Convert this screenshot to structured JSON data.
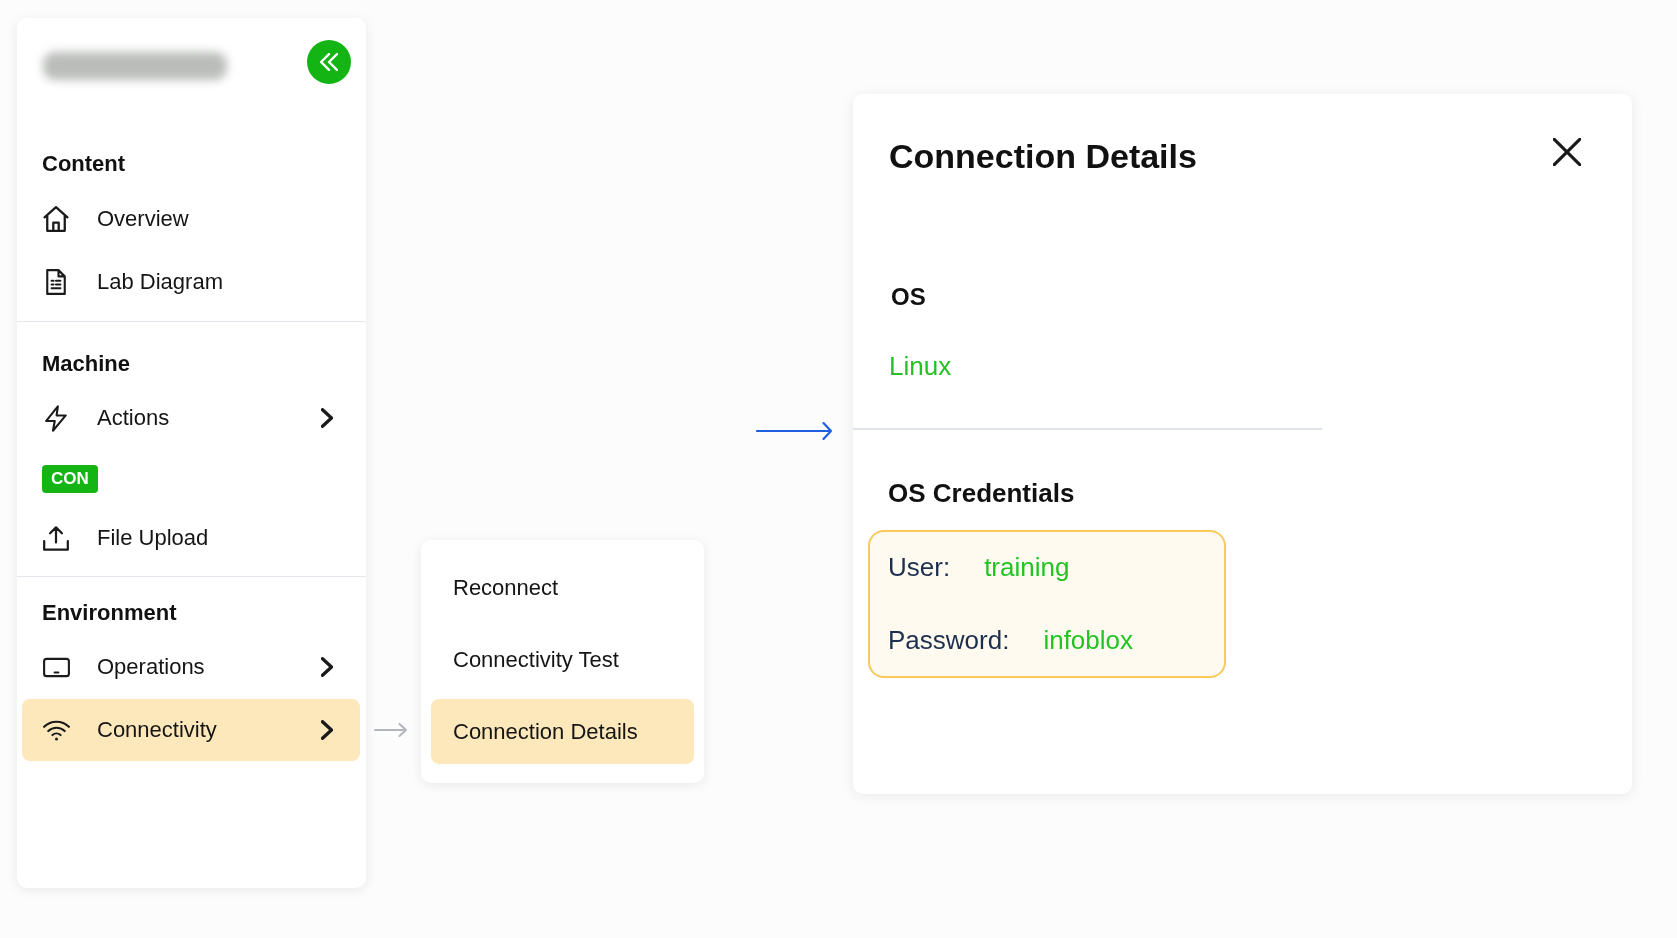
{
  "sidebar": {
    "sections": [
      {
        "heading": "Content",
        "items": [
          {
            "kind": "link",
            "label": "Overview",
            "submenu": false,
            "selected": false
          },
          {
            "kind": "link",
            "label": "Lab Diagram",
            "submenu": false,
            "selected": false
          }
        ]
      },
      {
        "heading": "Machine",
        "items": [
          {
            "kind": "link",
            "label": "Actions",
            "submenu": true,
            "selected": false
          },
          {
            "kind": "badge",
            "label": "CON"
          },
          {
            "kind": "link",
            "label": "File Upload",
            "submenu": false,
            "selected": false
          }
        ]
      },
      {
        "heading": "Environment",
        "items": [
          {
            "kind": "link",
            "label": "Operations",
            "submenu": true,
            "selected": false
          },
          {
            "kind": "link",
            "label": "Connectivity",
            "submenu": true,
            "selected": true
          }
        ]
      }
    ]
  },
  "submenu": {
    "items": [
      {
        "label": "Reconnect",
        "selected": false
      },
      {
        "label": "Connectivity Test",
        "selected": false
      },
      {
        "label": "Connection Details",
        "selected": true
      }
    ]
  },
  "details_panel": {
    "title": "Connection Details",
    "os": {
      "heading": "OS",
      "value": "Linux"
    },
    "credentials": {
      "heading": "OS Credentials",
      "fields": [
        {
          "label": "User:",
          "value": "training"
        },
        {
          "label": "Password:",
          "value": "infoblox"
        }
      ]
    }
  }
}
